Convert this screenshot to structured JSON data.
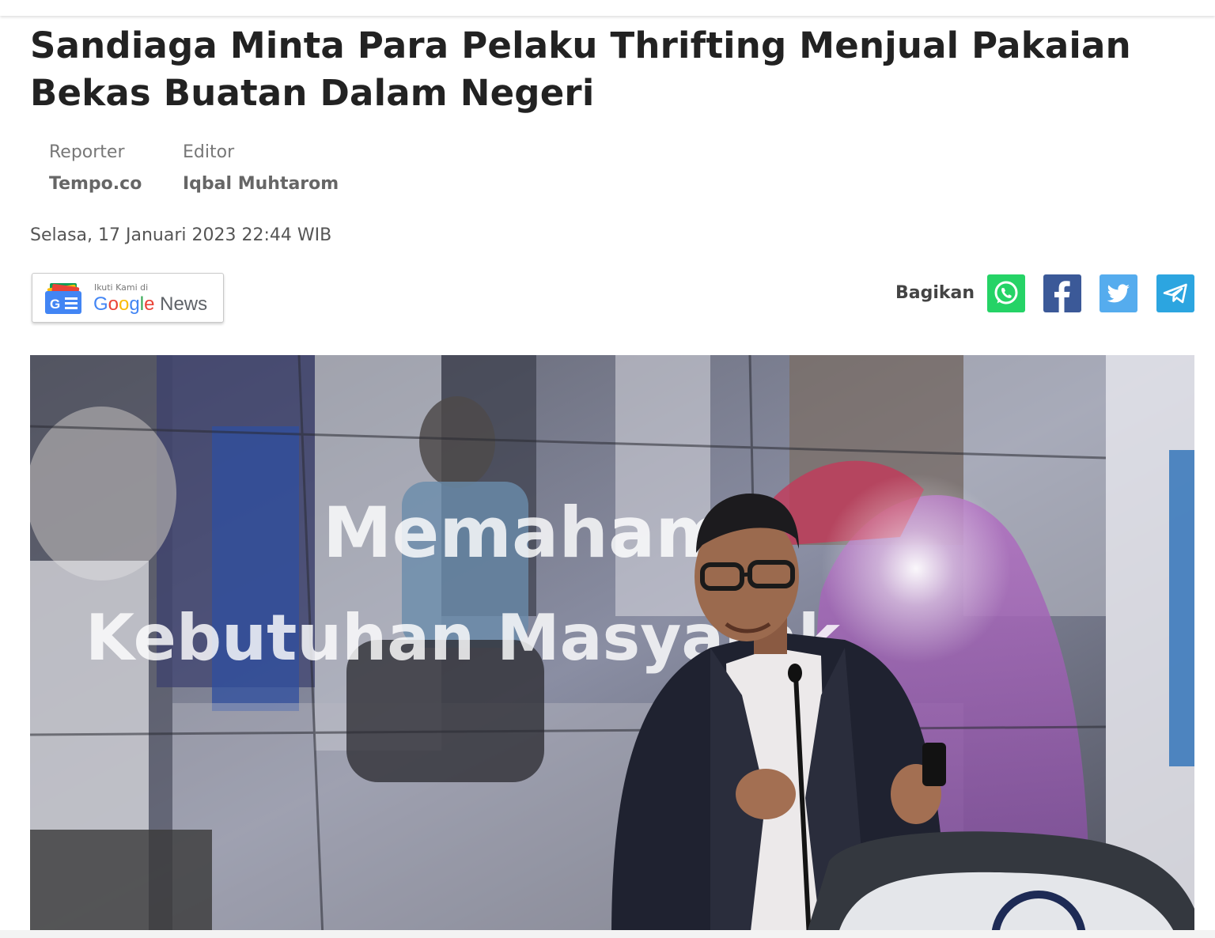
{
  "article": {
    "title": "Sandiaga Minta Para Pelaku Thrifting Menjual Pakaian Bekas Buatan Dalam Negeri",
    "reporter_label": "Reporter",
    "reporter_name": "Tempo.co",
    "editor_label": "Editor",
    "editor_name": "Iqbal Muhtarom",
    "date": "Selasa, 17 Januari 2023 22:44 WIB"
  },
  "google_news": {
    "follow_text": "Ikuti Kami di",
    "brand": {
      "G": "G",
      "o1": "o",
      "o2": "o",
      "g": "g",
      "l": "l",
      "e": "e",
      "news": "News"
    },
    "icon": "google-news-icon"
  },
  "share": {
    "label": "Bagikan",
    "buttons": [
      {
        "name": "whatsapp",
        "icon": "whatsapp-icon",
        "color": "#25d366"
      },
      {
        "name": "facebook",
        "icon": "facebook-icon",
        "color": "#3b5998"
      },
      {
        "name": "twitter",
        "icon": "twitter-icon",
        "color": "#55acee"
      },
      {
        "name": "telegram",
        "icon": "telegram-icon",
        "color": "#2ca5e0"
      }
    ]
  },
  "photo": {
    "screen_line1": "Memahami",
    "screen_line2": "Kebutuhan Masyarak"
  },
  "colors": {
    "title": "#222222",
    "meta": "#777777",
    "google_blue": "#4285f4",
    "google_red": "#ea4335",
    "google_yellow": "#fbbc05",
    "google_green": "#34a853"
  }
}
